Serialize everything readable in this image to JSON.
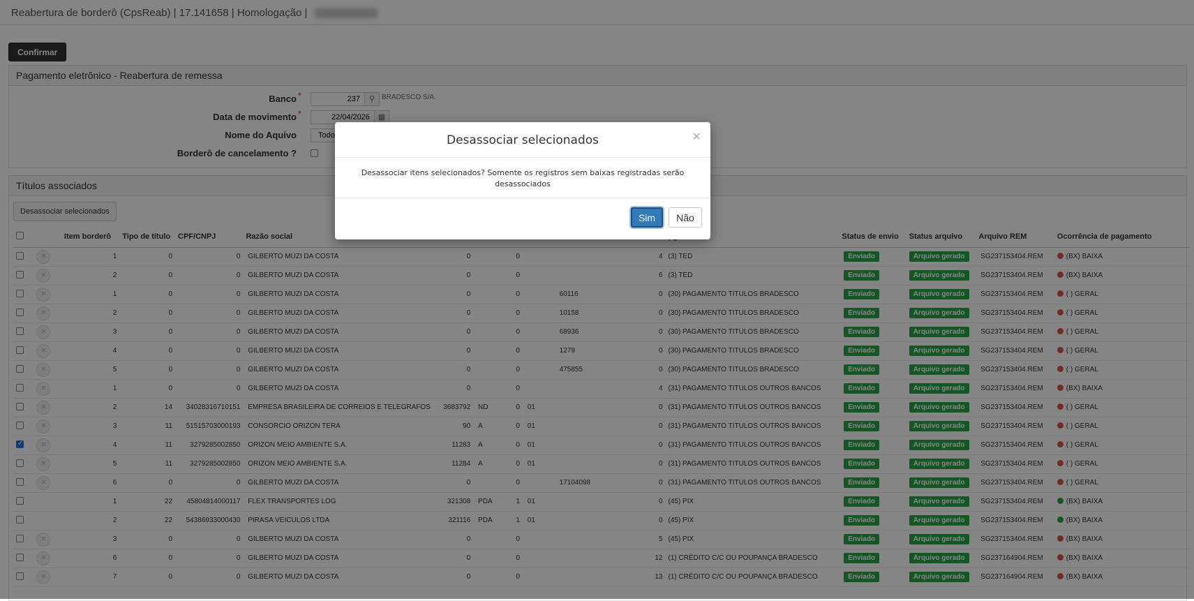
{
  "window": {
    "title": "Reabertura de borderô (CpsReab) | 17.141658 | Homologação |"
  },
  "toolbar": {
    "confirm_label": "Confirmar"
  },
  "form_panel": {
    "title": "Pagamento eletrônico - Reabertura de remessa",
    "banco_label": "Banco",
    "banco_value": "237",
    "banco_name": "BRADESCO S/A.",
    "data_label": "Data de movimento",
    "data_value": "22/04/2026",
    "arquivo_label": "Nome do Aquivo",
    "arquivo_value": "Todos",
    "cancel_label": "Borderô de cancelamento ?"
  },
  "grid_panel": {
    "title": "Títulos associados",
    "desassociar_label": "Desassociar selecionados",
    "columns": {
      "item": "Item borderô",
      "tipo": "Tipo de título",
      "cpf": "CPF/CNPJ",
      "razao": "Razão social",
      "fpgto": "pgto",
      "status_envio": "Status de envio",
      "status_arquivo": "Status arquivo",
      "arquivo_rem": "Arquivo REM",
      "ocorrencia": "Ocorrência de pagamento"
    },
    "rows": [
      {
        "checked": false,
        "x": true,
        "item": "1",
        "tipo": "0",
        "cpf": "0",
        "razao": "GILBERTO MUZI DA COSTA",
        "c1": "0",
        "c2": "",
        "c3": "0",
        "c4": "",
        "c5": "",
        "c6": "4",
        "fpgto": "(3) TED",
        "status_envio": "Enviado",
        "status_arquivo": "Arquivo gerado",
        "rem": "SG237153404.REM",
        "dot": "#d9534f",
        "oco": "(BX) BAIXA"
      },
      {
        "checked": false,
        "x": true,
        "item": "2",
        "tipo": "0",
        "cpf": "0",
        "razao": "GILBERTO MUZI DA COSTA",
        "c1": "0",
        "c2": "",
        "c3": "0",
        "c4": "",
        "c5": "",
        "c6": "6",
        "fpgto": "(3) TED",
        "status_envio": "Enviado",
        "status_arquivo": "Arquivo gerado",
        "rem": "SG237153404.REM",
        "dot": "#d9534f",
        "oco": "(BX) BAIXA"
      },
      {
        "checked": false,
        "x": true,
        "item": "1",
        "tipo": "0",
        "cpf": "0",
        "razao": "GILBERTO MUZI DA COSTA",
        "c1": "0",
        "c2": "",
        "c3": "0",
        "c4": "",
        "c5": "60116",
        "c6": "0",
        "fpgto": "(30) PAGAMENTO TITULOS BRADESCO",
        "status_envio": "Enviado",
        "status_arquivo": "Arquivo gerado",
        "rem": "SG237153404.REM",
        "dot": "#d9534f",
        "oco": "( ) GERAL"
      },
      {
        "checked": false,
        "x": true,
        "item": "2",
        "tipo": "0",
        "cpf": "0",
        "razao": "GILBERTO MUZI DA COSTA",
        "c1": "0",
        "c2": "",
        "c3": "0",
        "c4": "",
        "c5": "10158",
        "c6": "0",
        "fpgto": "(30) PAGAMENTO TITULOS BRADESCO",
        "status_envio": "Enviado",
        "status_arquivo": "Arquivo gerado",
        "rem": "SG237153404.REM",
        "dot": "#d9534f",
        "oco": "( ) GERAL"
      },
      {
        "checked": false,
        "x": true,
        "item": "3",
        "tipo": "0",
        "cpf": "0",
        "razao": "GILBERTO MUZI DA COSTA",
        "c1": "0",
        "c2": "",
        "c3": "0",
        "c4": "",
        "c5": "68936",
        "c6": "0",
        "fpgto": "(30) PAGAMENTO TITULOS BRADESCO",
        "status_envio": "Enviado",
        "status_arquivo": "Arquivo gerado",
        "rem": "SG237153404.REM",
        "dot": "#d9534f",
        "oco": "( ) GERAL"
      },
      {
        "checked": false,
        "x": true,
        "item": "4",
        "tipo": "0",
        "cpf": "0",
        "razao": "GILBERTO MUZI DA COSTA",
        "c1": "0",
        "c2": "",
        "c3": "0",
        "c4": "",
        "c5": "1279",
        "c6": "0",
        "fpgto": "(30) PAGAMENTO TITULOS BRADESCO",
        "status_envio": "Enviado",
        "status_arquivo": "Arquivo gerado",
        "rem": "SG237153404.REM",
        "dot": "#d9534f",
        "oco": "( ) GERAL"
      },
      {
        "checked": false,
        "x": true,
        "item": "5",
        "tipo": "0",
        "cpf": "0",
        "razao": "GILBERTO MUZI DA COSTA",
        "c1": "0",
        "c2": "",
        "c3": "0",
        "c4": "",
        "c5": "475855",
        "c6": "0",
        "fpgto": "(30) PAGAMENTO TITULOS BRADESCO",
        "status_envio": "Enviado",
        "status_arquivo": "Arquivo gerado",
        "rem": "SG237153404.REM",
        "dot": "#d9534f",
        "oco": "( ) GERAL"
      },
      {
        "checked": false,
        "x": true,
        "item": "1",
        "tipo": "0",
        "cpf": "0",
        "razao": "GILBERTO MUZI DA COSTA",
        "c1": "0",
        "c2": "",
        "c3": "0",
        "c4": "",
        "c5": "",
        "c6": "4",
        "fpgto": "(31) PAGAMENTO TITULOS OUTROS BANCOS",
        "status_envio": "Enviado",
        "status_arquivo": "Arquivo gerado",
        "rem": "SG237153404.REM",
        "dot": "#d9534f",
        "oco": "(BX) BAIXA"
      },
      {
        "checked": false,
        "x": true,
        "item": "2",
        "tipo": "14",
        "cpf": "34028316710151",
        "razao": "EMPRESA BRASILEIRA DE CORREIOS E TELEGRAFOS",
        "c1": "3683792",
        "c2": "ND",
        "c3": "0",
        "c4": "01",
        "c5": "",
        "c6": "0",
        "fpgto": "(31) PAGAMENTO TITULOS OUTROS BANCOS",
        "status_envio": "Enviado",
        "status_arquivo": "Arquivo gerado",
        "rem": "SG237153404.REM",
        "dot": "#d9534f",
        "oco": "( ) GERAL"
      },
      {
        "checked": false,
        "x": true,
        "item": "3",
        "tipo": "11",
        "cpf": "51515703000193",
        "razao": "CONSORCIO ORIZON TERA",
        "c1": "90",
        "c2": "A",
        "c3": "0",
        "c4": "01",
        "c5": "",
        "c6": "0",
        "fpgto": "(31) PAGAMENTO TITULOS OUTROS BANCOS",
        "status_envio": "Enviado",
        "status_arquivo": "Arquivo gerado",
        "rem": "SG237153404.REM",
        "dot": "#d9534f",
        "oco": "( ) GERAL"
      },
      {
        "checked": true,
        "x": true,
        "item": "4",
        "tipo": "11",
        "cpf": "3279285002850",
        "razao": "ORIZON MEIO AMBIENTE S.A.",
        "c1": "11283",
        "c2": "A",
        "c3": "0",
        "c4": "01",
        "c5": "",
        "c6": "0",
        "fpgto": "(31) PAGAMENTO TITULOS OUTROS BANCOS",
        "status_envio": "Enviado",
        "status_arquivo": "Arquivo gerado",
        "rem": "SG237153404.REM",
        "dot": "#d9534f",
        "oco": "( ) GERAL"
      },
      {
        "checked": false,
        "x": true,
        "item": "5",
        "tipo": "11",
        "cpf": "3279285002850",
        "razao": "ORIZON MEIO AMBIENTE S.A.",
        "c1": "11284",
        "c2": "A",
        "c3": "0",
        "c4": "01",
        "c5": "",
        "c6": "0",
        "fpgto": "(31) PAGAMENTO TITULOS OUTROS BANCOS",
        "status_envio": "Enviado",
        "status_arquivo": "Arquivo gerado",
        "rem": "SG237153404.REM",
        "dot": "#d9534f",
        "oco": "( ) GERAL"
      },
      {
        "checked": false,
        "x": true,
        "item": "6",
        "tipo": "0",
        "cpf": "0",
        "razao": "GILBERTO MUZI DA COSTA",
        "c1": "0",
        "c2": "",
        "c3": "0",
        "c4": "",
        "c5": "17104098",
        "c6": "0",
        "fpgto": "(31) PAGAMENTO TITULOS OUTROS BANCOS",
        "status_envio": "Enviado",
        "status_arquivo": "Arquivo gerado",
        "rem": "SG237153404.REM",
        "dot": "#d9534f",
        "oco": "( ) GERAL"
      },
      {
        "checked": false,
        "x": false,
        "item": "1",
        "tipo": "22",
        "cpf": "45804814000117",
        "razao": "FLEX TRANSPORTES LOG",
        "c1": "321308",
        "c2": "PDA",
        "c3": "1",
        "c4": "01",
        "c5": "",
        "c6": "0",
        "fpgto": "(45) PIX",
        "status_envio": "Enviado",
        "status_arquivo": "Arquivo gerado",
        "rem": "SG237153404.REM",
        "dot": "#28a745",
        "oco": "(BX) BAIXA"
      },
      {
        "checked": false,
        "x": false,
        "item": "2",
        "tipo": "22",
        "cpf": "54386933000430",
        "razao": "PIRASA VEICULOS LTDA",
        "c1": "321116",
        "c2": "PDA",
        "c3": "1",
        "c4": "01",
        "c5": "",
        "c6": "0",
        "fpgto": "(45) PIX",
        "status_envio": "Enviado",
        "status_arquivo": "Arquivo gerado",
        "rem": "SG237153404.REM",
        "dot": "#28a745",
        "oco": "(BX) BAIXA"
      },
      {
        "checked": false,
        "x": true,
        "item": "3",
        "tipo": "0",
        "cpf": "0",
        "razao": "GILBERTO MUZI DA COSTA",
        "c1": "0",
        "c2": "",
        "c3": "0",
        "c4": "",
        "c5": "",
        "c6": "5",
        "fpgto": "(45) PIX",
        "status_envio": "Enviado",
        "status_arquivo": "Arquivo gerado",
        "rem": "SG237153404.REM",
        "dot": "#d9534f",
        "oco": "(BX) BAIXA"
      },
      {
        "checked": false,
        "x": true,
        "item": "6",
        "tipo": "0",
        "cpf": "0",
        "razao": "GILBERTO MUZI DA COSTA",
        "c1": "0",
        "c2": "",
        "c3": "0",
        "c4": "",
        "c5": "",
        "c6": "12",
        "fpgto": "(1) CRÉDITO C/C OU POUPANÇA BRADESCO",
        "status_envio": "Enviado",
        "status_arquivo": "Arquivo gerado",
        "rem": "SG237164904.REM",
        "dot": "#d9534f",
        "oco": "(BX) BAIXA"
      },
      {
        "checked": false,
        "x": true,
        "item": "7",
        "tipo": "0",
        "cpf": "0",
        "razao": "GILBERTO MUZI DA COSTA",
        "c1": "0",
        "c2": "",
        "c3": "0",
        "c4": "",
        "c5": "",
        "c6": "13",
        "fpgto": "(1) CRÉDITO C/C OU POUPANÇA BRADESCO",
        "status_envio": "Enviado",
        "status_arquivo": "Arquivo gerado",
        "rem": "SG237164904.REM",
        "dot": "#d9534f",
        "oco": "(BX) BAIXA"
      }
    ]
  },
  "modal": {
    "title": "Desassociar selecionados",
    "message": "Desassociar itens selecionados? Somente os registros sem baixas registradas serão desassociados",
    "yes_label": "Sim",
    "no_label": "Não",
    "close_glyph": "×"
  }
}
